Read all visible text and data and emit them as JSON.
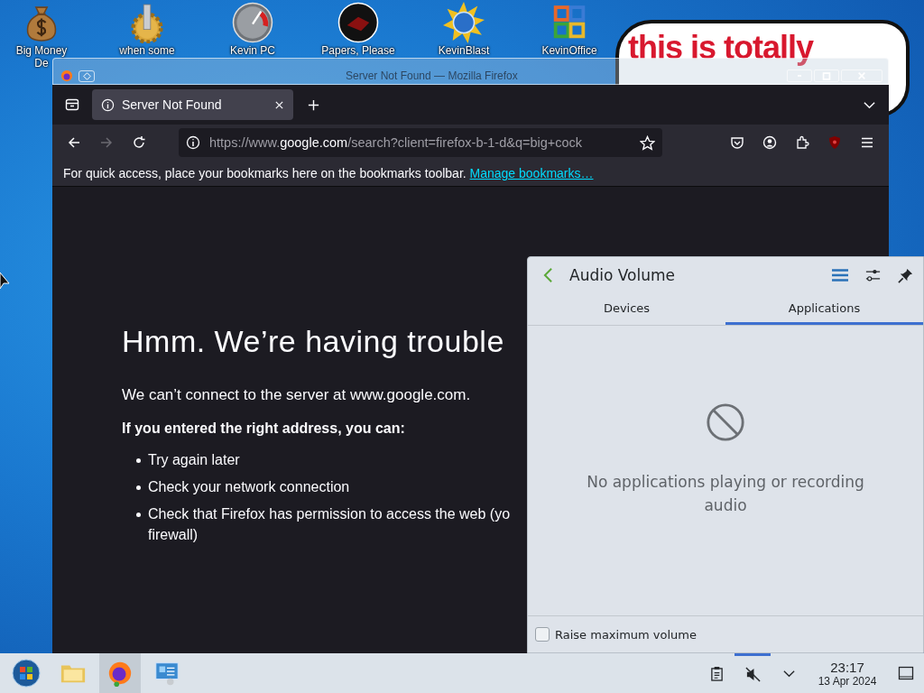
{
  "desktop_icons": [
    {
      "kind": "money",
      "lines": [
        "Big Money",
        "De"
      ]
    },
    {
      "kind": "gear",
      "lines": [
        "when some"
      ]
    },
    {
      "kind": "gauge",
      "lines": [
        "Kevin PC"
      ]
    },
    {
      "kind": "papers",
      "lines": [
        "Papers, Please"
      ]
    },
    {
      "kind": "sun",
      "lines": [
        "KevinBlast"
      ]
    },
    {
      "kind": "office",
      "lines": [
        "KevinOffice"
      ]
    }
  ],
  "wallpaper_bubble": {
    "lines": [
      "this is totally"
    ]
  },
  "browser": {
    "title": "Server Not Found — Mozilla Firefox",
    "tabs": [
      {
        "title": "Server Not Found",
        "selected": true
      }
    ],
    "forward_disabled": true,
    "url": {
      "prefix": "https://www.",
      "host": "google.com",
      "rest": "/search?client=firefox-b-1-d&q=big+cock"
    },
    "bookmarks_hint": "For quick access, place your bookmarks here on the bookmarks toolbar.",
    "bookmarks_link": "Manage bookmarks…",
    "error": {
      "heading": "Hmm. We’re having trouble",
      "message": "We can’t connect to the server at www.google.com.",
      "advice": "If you entered the right address, you can:",
      "items": [
        {
          "lines": [
            "Try again later"
          ]
        },
        {
          "lines": [
            "Check your network connection"
          ]
        },
        {
          "lines": [
            "Check that Firefox has permission to access the web (yo",
            "firewall)"
          ]
        }
      ]
    }
  },
  "audio": {
    "title": "Audio Volume",
    "tabs": [
      {
        "label": "Devices",
        "selected": false
      },
      {
        "label": "Applications",
        "selected": true
      }
    ],
    "empty_message": "No applications playing or recording audio",
    "raise_max": {
      "label": "Raise maximum volume",
      "checked": false
    }
  },
  "taskbar": {
    "apps": [
      {
        "kind": "files",
        "active": false
      },
      {
        "kind": "firefox",
        "active": true
      },
      {
        "kind": "remote",
        "active": false
      }
    ],
    "volume_muted": true,
    "clock": {
      "time": "23:17",
      "date": "13 Apr 2024"
    }
  }
}
